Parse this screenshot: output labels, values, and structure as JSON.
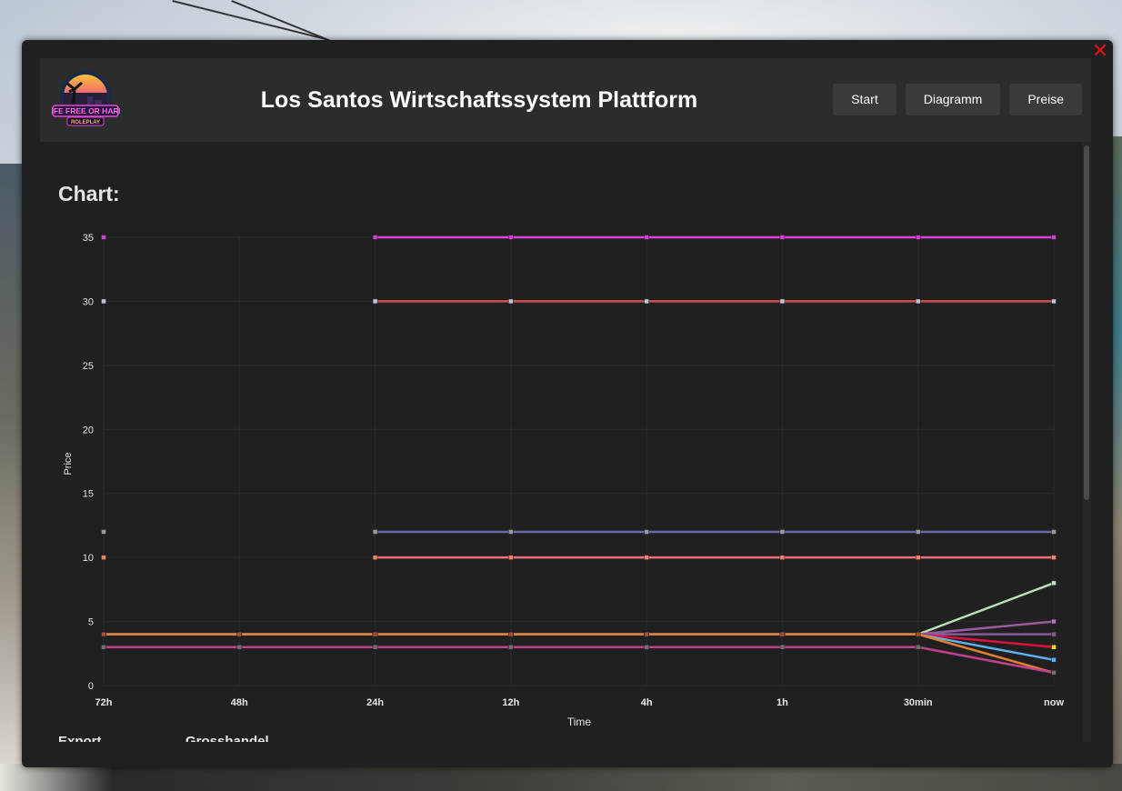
{
  "window": {
    "title": "Los Santos Wirtschaftssystem Plattform",
    "logo_text_line1": "LIFE FREE OR HARD",
    "logo_text_line2": "ROLEPLAY",
    "close_icon": "close-icon"
  },
  "nav": {
    "start": "Start",
    "diagramm": "Diagramm",
    "preise": "Preise"
  },
  "content": {
    "chart_heading": "Chart:",
    "section_export": "Export",
    "section_grosshandel": "Grosshandel"
  },
  "chart_data": {
    "type": "line",
    "xlabel": "Time",
    "ylabel": "Price",
    "categories": [
      "72h",
      "48h",
      "24h",
      "12h",
      "4h",
      "1h",
      "30min",
      "now"
    ],
    "ylim": [
      0,
      35
    ],
    "yticks": [
      0,
      5,
      10,
      15,
      20,
      25,
      30,
      35
    ],
    "grid": true,
    "series": [
      {
        "color": "#e040e0",
        "point": "#d040d0",
        "values": [
          35,
          null,
          35,
          35,
          35,
          35,
          35,
          35
        ]
      },
      {
        "color": "#d05050",
        "point": "#c0c8d8",
        "values": [
          30,
          null,
          30,
          30,
          30,
          30,
          30,
          30
        ]
      },
      {
        "color": "#6a6aa8",
        "point": "#9a9a9a",
        "values": [
          12,
          null,
          12,
          12,
          12,
          12,
          12,
          12
        ]
      },
      {
        "color": "#f07080",
        "point": "#f08070",
        "values": [
          10,
          null,
          10,
          10,
          10,
          10,
          10,
          10
        ]
      },
      {
        "color": "#b8e0b8",
        "point": "#b8e0b8",
        "values": [
          4,
          4,
          4,
          4,
          4,
          4,
          4,
          8
        ]
      },
      {
        "color": "#9a5aa0",
        "point": "#b070c0",
        "values": [
          4,
          4,
          4,
          4,
          4,
          4,
          4,
          5
        ]
      },
      {
        "color": "#8a5a9a",
        "point": "#7a5a8a",
        "values": [
          4,
          4,
          4,
          4,
          4,
          4,
          4,
          4
        ]
      },
      {
        "color": "#e01040",
        "point": "#f0e000",
        "values": [
          4,
          4,
          4,
          4,
          4,
          4,
          4,
          3
        ]
      },
      {
        "color": "#60b0f0",
        "point": "#60b0f0",
        "values": [
          4,
          4,
          4,
          4,
          4,
          4,
          4,
          2
        ]
      },
      {
        "color": "#e08030",
        "point": "#a05030",
        "values": [
          4,
          4,
          4,
          4,
          4,
          4,
          4,
          1
        ]
      },
      {
        "color": "#c04090",
        "point": "#707070",
        "values": [
          3,
          3,
          3,
          3,
          3,
          3,
          3,
          1
        ]
      }
    ]
  }
}
